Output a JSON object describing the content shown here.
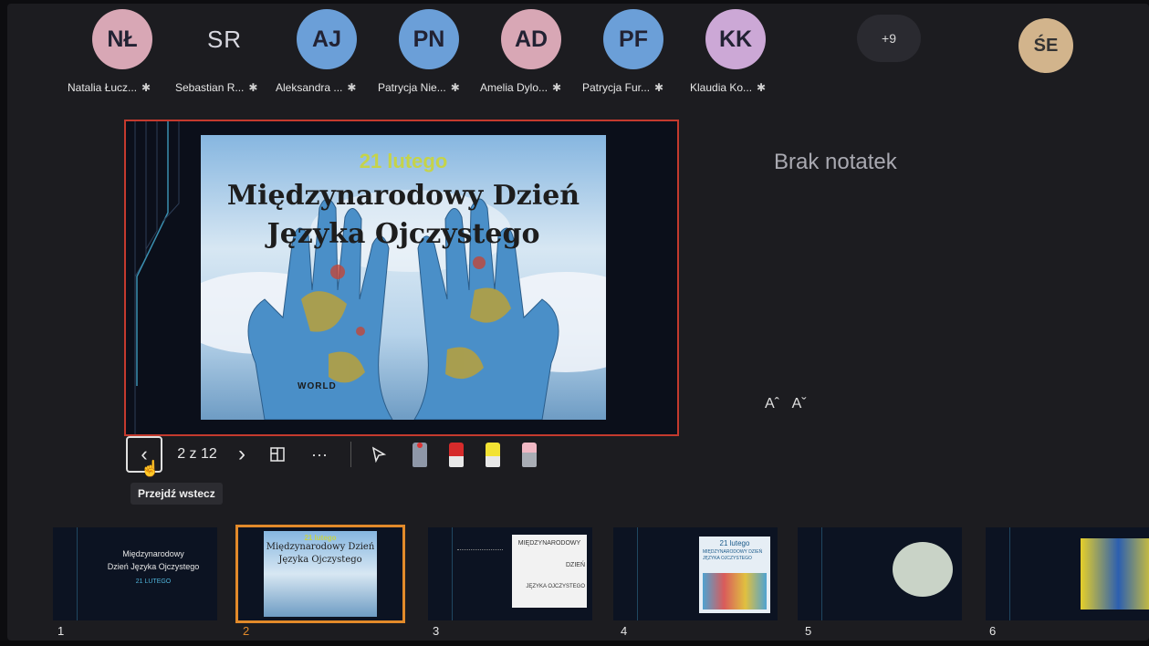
{
  "participants": [
    {
      "initials": "NŁ",
      "name": "Natalia Łucz...",
      "color": "#d8a7b5"
    },
    {
      "initials": "SR",
      "name": "Sebastian R...",
      "color": "transparent"
    },
    {
      "initials": "AJ",
      "name": "Aleksandra ...",
      "color": "#6b9fd8"
    },
    {
      "initials": "PN",
      "name": "Patrycja Nie...",
      "color": "#6b9fd8"
    },
    {
      "initials": "AD",
      "name": "Amelia Dylo...",
      "color": "#d8a7b5"
    },
    {
      "initials": "PF",
      "name": "Patrycja Fur...",
      "color": "#6b9fd8"
    },
    {
      "initials": "KK",
      "name": "Klaudia Ko...",
      "color": "#cca8d6"
    }
  ],
  "more_count": "+9",
  "self": {
    "initials": "ŚE"
  },
  "slide": {
    "date": "21 lutego",
    "title_line1": "Międzynarodowy Dzień",
    "title_line2": "Języka Ojczystego",
    "world": "WORLD"
  },
  "notes": {
    "text": "Brak notatek",
    "increase": "Aˆ",
    "decrease": "Aˇ"
  },
  "toolbar": {
    "counter": "2 z 12",
    "prev_tooltip": "Przejdź wstecz",
    "next": "›",
    "more": "···"
  },
  "thumbnails": [
    {
      "number": "1",
      "line1": "Międzynarodowy",
      "line2": "Dzień Języka Ojczystego",
      "line3": "21 LUTEGO"
    },
    {
      "number": "2",
      "line1": "21 lutego",
      "line2": "Międzynarodowy Dzień",
      "line3": "Języka Ojczystego"
    },
    {
      "number": "3",
      "line1": "MIĘDZYNARODOWY",
      "line2": "DZIEŃ",
      "line3": "JĘZYKA OJCZYSTEGO"
    },
    {
      "number": "4",
      "line1": "21 lutego",
      "line2": "MIĘDZYNARODOWY DZIEŃ JĘZYKA OJCZYSTEGO",
      "line3": ""
    },
    {
      "number": "5",
      "line1": "",
      "line2": "",
      "line3": ""
    },
    {
      "number": "6",
      "line1": "",
      "line2": "",
      "line3": ""
    }
  ]
}
